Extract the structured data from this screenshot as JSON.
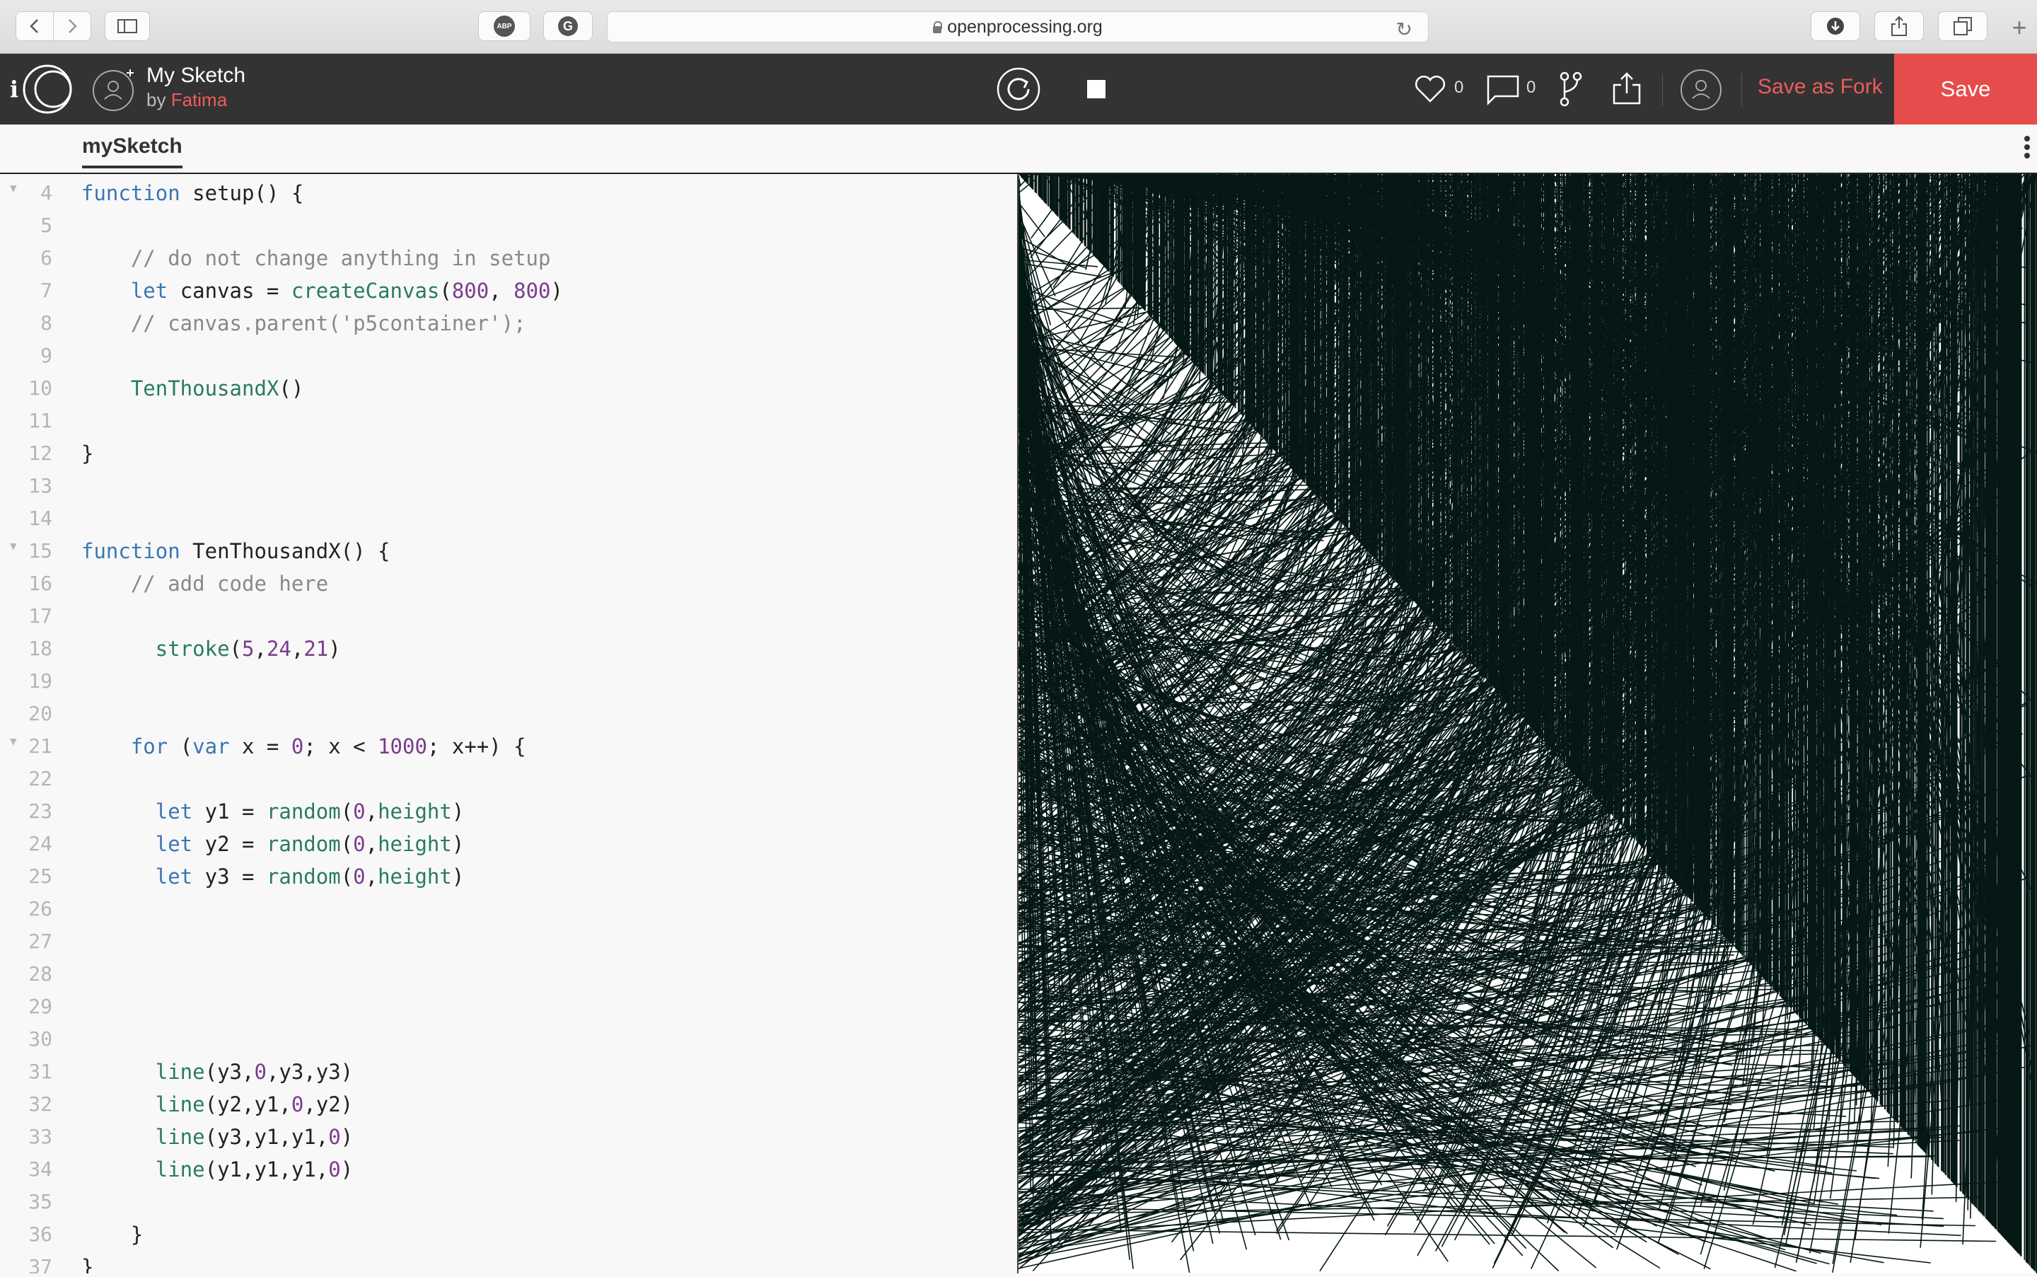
{
  "browser": {
    "url": "openprocessing.org",
    "abp_label": "ABP"
  },
  "header": {
    "title": "My Sketch",
    "by_prefix": "by ",
    "author": "Fatima",
    "info_label": "i",
    "likes": "0",
    "comments": "0",
    "save_as_fork": "Save as Fork",
    "save": "Save"
  },
  "tabs": {
    "active": "mySketch"
  },
  "code_lines": [
    {
      "n": "4",
      "fold": true,
      "html": "<span class=\"kw\">function</span> setup() {"
    },
    {
      "n": "5",
      "html": ""
    },
    {
      "n": "6",
      "html": "    <span class=\"cm\">// do not change anything in setup</span>"
    },
    {
      "n": "7",
      "html": "    <span class=\"kw\">let</span> canvas = <span class=\"fn\">createCanvas</span>(<span class=\"num\">800</span>, <span class=\"num\">800</span>)"
    },
    {
      "n": "8",
      "html": "    <span class=\"cm\">// canvas.parent('p5container');</span>"
    },
    {
      "n": "9",
      "html": ""
    },
    {
      "n": "10",
      "html": "    <span class=\"fn\">TenThousandX</span>()"
    },
    {
      "n": "11",
      "html": ""
    },
    {
      "n": "12",
      "html": "}"
    },
    {
      "n": "13",
      "html": ""
    },
    {
      "n": "14",
      "html": ""
    },
    {
      "n": "15",
      "fold": true,
      "html": "<span class=\"kw\">function</span> TenThousandX() {"
    },
    {
      "n": "16",
      "html": "    <span class=\"cm\">// add code here</span>"
    },
    {
      "n": "17",
      "html": ""
    },
    {
      "n": "18",
      "html": "      <span class=\"fn\">stroke</span>(<span class=\"num\">5</span>,<span class=\"num\">24</span>,<span class=\"num\">21</span>)"
    },
    {
      "n": "19",
      "html": ""
    },
    {
      "n": "20",
      "html": ""
    },
    {
      "n": "21",
      "fold": true,
      "html": "    <span class=\"kw\">for</span> (<span class=\"kw\">var</span> x = <span class=\"num\">0</span>; x &lt; <span class=\"num\">1000</span>; x++) {"
    },
    {
      "n": "22",
      "html": ""
    },
    {
      "n": "23",
      "html": "      <span class=\"kw\">let</span> y1 = <span class=\"fn\">random</span>(<span class=\"num\">0</span>,<span class=\"fn\">height</span>)"
    },
    {
      "n": "24",
      "html": "      <span class=\"kw\">let</span> y2 = <span class=\"fn\">random</span>(<span class=\"num\">0</span>,<span class=\"fn\">height</span>)"
    },
    {
      "n": "25",
      "html": "      <span class=\"kw\">let</span> y3 = <span class=\"fn\">random</span>(<span class=\"num\">0</span>,<span class=\"fn\">height</span>)"
    },
    {
      "n": "26",
      "html": ""
    },
    {
      "n": "27",
      "html": ""
    },
    {
      "n": "28",
      "html": ""
    },
    {
      "n": "29",
      "html": ""
    },
    {
      "n": "30",
      "html": ""
    },
    {
      "n": "31",
      "html": "      <span class=\"fn\">line</span>(y3,<span class=\"num\">0</span>,y3,y3)"
    },
    {
      "n": "32",
      "html": "      <span class=\"fn\">line</span>(y2,y1,<span class=\"num\">0</span>,y2)"
    },
    {
      "n": "33",
      "html": "      <span class=\"fn\">line</span>(y3,y1,y1,<span class=\"num\">0</span>)"
    },
    {
      "n": "34",
      "html": "      <span class=\"fn\">line</span>(y1,y1,y1,<span class=\"num\">0</span>)"
    },
    {
      "n": "35",
      "html": ""
    },
    {
      "n": "36",
      "html": "    }"
    },
    {
      "n": "37",
      "html": "}"
    }
  ],
  "sketch": {
    "stroke_color": "#051815",
    "background": "#ffffff"
  }
}
